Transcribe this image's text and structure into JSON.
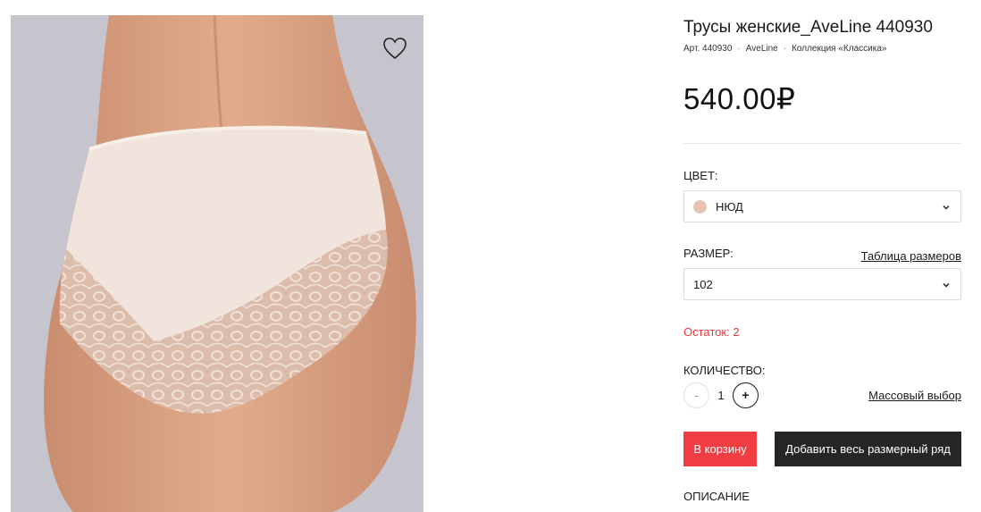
{
  "product": {
    "title": "Трусы женские_AveLine 440930",
    "article": "Арт. 440930",
    "brand": "AveLine",
    "collection": "Коллекция «Классика»",
    "meta_separator": "·",
    "price": "540.00₽"
  },
  "color": {
    "label": "ЦВЕТ:",
    "selected": "НЮД",
    "swatch": "#e8c3b3"
  },
  "size": {
    "label": "РАЗМЕР:",
    "selected": "102",
    "table_link": "Таблица размеров"
  },
  "stock": {
    "text": "Остаток: 2",
    "color": "#e43b3b"
  },
  "quantity": {
    "label": "КОЛИЧЕСТВО:",
    "value": "1",
    "minus": "-",
    "plus": "+",
    "bulk_link": "Массовый выбор"
  },
  "actions": {
    "add_to_cart": "В корзину",
    "add_all_sizes": "Добавить весь размерный ряд",
    "cart_color": "#ef3d42",
    "all_color": "#262626"
  },
  "description": {
    "label": "ОПИСАНИЕ"
  },
  "icons": {
    "favorite": "heart-icon",
    "dropdown": "chevron-down-icon"
  }
}
